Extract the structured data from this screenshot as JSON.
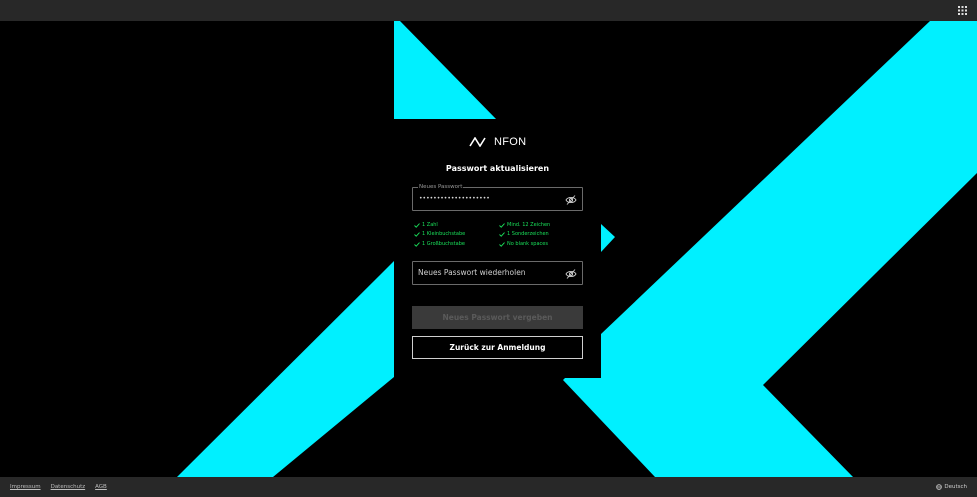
{
  "brand": {
    "name": "NFON",
    "accent": "#00f0ff"
  },
  "topbar": {
    "apps_icon": "grid-icon"
  },
  "card": {
    "title": "Passwort aktualisieren",
    "password_field": {
      "label": "Neues Passwort",
      "value": "••••••••••••••••••••",
      "icon": "eye-off-icon"
    },
    "rules_left": [
      "1 Zahl",
      "1 Kleinbuchstabe",
      "1 Großbuchstabe"
    ],
    "rules_right": [
      "Mind. 12 Zeichen",
      "1 Sonderzeichen",
      "No blank spaces"
    ],
    "rule_color": "#19e05a",
    "repeat_field": {
      "placeholder": "Neues Passwort wiederholen",
      "icon": "eye-off-icon"
    },
    "submit_label": "Neues Passwort vergeben",
    "back_label": "Zurück zur Anmeldung"
  },
  "footer": {
    "links": [
      "Impressum",
      "Datenschutz",
      "AGB"
    ],
    "language": "Deutsch",
    "language_icon": "globe-icon"
  }
}
